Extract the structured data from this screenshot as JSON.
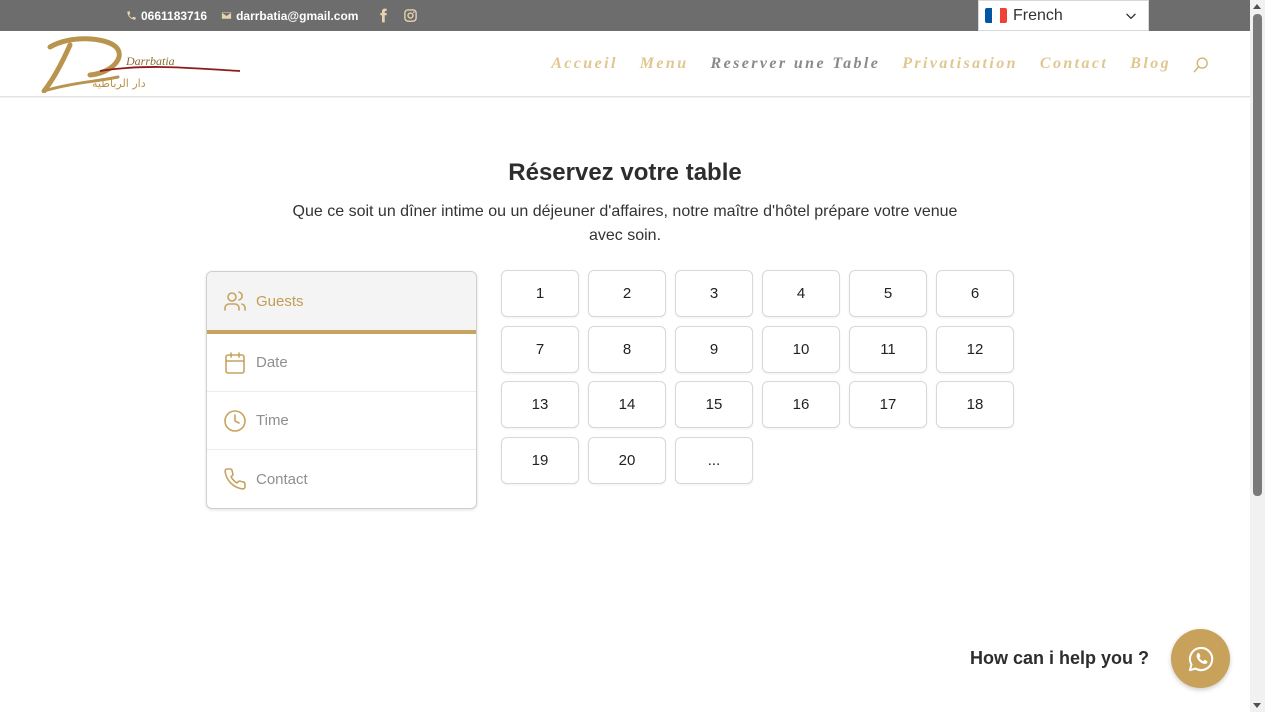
{
  "topbar": {
    "phone": "0661183716",
    "email": "darrbatia@gmail.com",
    "social": [
      "facebook-icon",
      "instagram-icon"
    ]
  },
  "language": {
    "selected": "French",
    "flag_colors": [
      "#0055a4",
      "#ffffff",
      "#ef4135"
    ]
  },
  "header": {
    "logo_text": "Darrbatia",
    "logo_arabic": "دار الرباطية",
    "nav": [
      {
        "label": "Accueil",
        "active": false
      },
      {
        "label": "Menu",
        "active": false
      },
      {
        "label": "Reserver une Table",
        "active": true
      },
      {
        "label": "Privatisation",
        "active": false
      },
      {
        "label": "Contact",
        "active": false
      },
      {
        "label": "Blog",
        "active": false
      }
    ]
  },
  "main": {
    "title": "Réservez votre table",
    "subtitle": "Que ce soit un dîner intime ou un déjeuner d'affaires, notre maître d'hôtel prépare votre venue avec soin."
  },
  "steps": [
    {
      "label": "Guests",
      "icon": "users-icon",
      "active": true
    },
    {
      "label": "Date",
      "icon": "calendar-icon",
      "active": false
    },
    {
      "label": "Time",
      "icon": "clock-icon",
      "active": false
    },
    {
      "label": "Contact",
      "icon": "phone-icon",
      "active": false
    }
  ],
  "guest_options": [
    "1",
    "2",
    "3",
    "4",
    "5",
    "6",
    "7",
    "8",
    "9",
    "10",
    "11",
    "12",
    "13",
    "14",
    "15",
    "16",
    "17",
    "18",
    "19",
    "20",
    "..."
  ],
  "chat": {
    "label": "How can i help you ?",
    "icon": "whatsapp-icon"
  },
  "colors": {
    "accent": "#c6a35e",
    "nav_text": "#dfc78f",
    "nav_active": "#8a8a8a",
    "topbar_bg": "#6d6d6d"
  }
}
